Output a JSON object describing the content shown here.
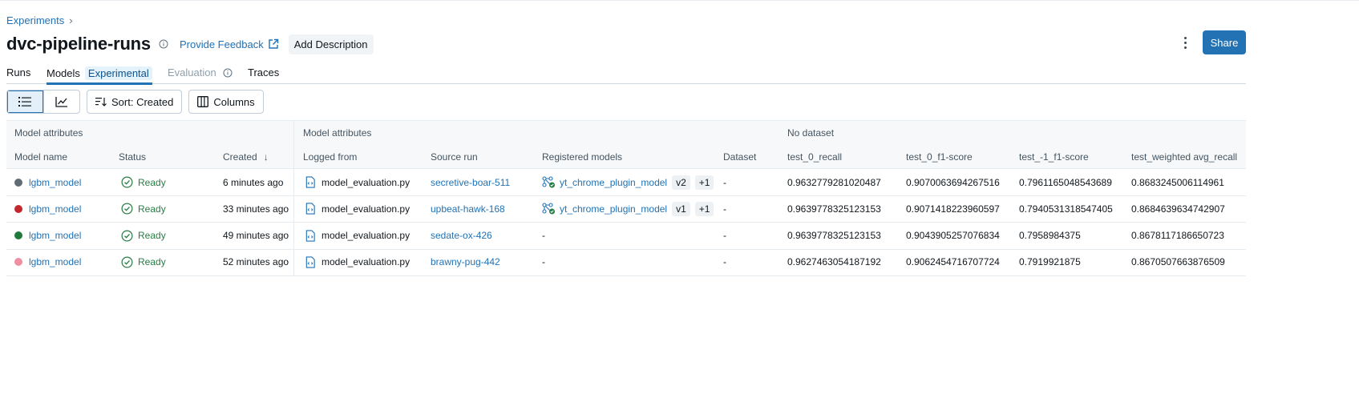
{
  "breadcrumb": {
    "parent": "Experiments",
    "separator": "›"
  },
  "header": {
    "title": "dvc-pipeline-runs",
    "feedback_label": "Provide Feedback",
    "add_description_label": "Add Description",
    "share_label": "Share"
  },
  "tabs": [
    {
      "label": "Runs"
    },
    {
      "label": "Models",
      "badge": "Experimental"
    },
    {
      "label": "Evaluation"
    },
    {
      "label": "Traces"
    }
  ],
  "toolbar": {
    "sort_label": "Sort: Created",
    "columns_label": "Columns"
  },
  "table": {
    "groups": [
      "Model attributes",
      "Model attributes",
      "No dataset"
    ],
    "columns": [
      "Model name",
      "Status",
      "Created",
      "Logged from",
      "Source run",
      "Registered models",
      "Dataset",
      "test_0_recall",
      "test_0_f1-score",
      "test_-1_f1-score",
      "test_weighted avg_recall"
    ],
    "sort_arrow": "↓",
    "rows": [
      {
        "color": "#5f6b75",
        "name": "lgbm_model",
        "status": "Ready",
        "created": "6 minutes ago",
        "logged_from": "model_evaluation.py",
        "source_run": "secretive-boar-511",
        "registered": "yt_chrome_plugin_model",
        "version": "v2",
        "more": "+1",
        "dataset": "-",
        "m1": "0.9632779281020487",
        "m2": "0.9070063694267516",
        "m3": "0.7961165048543689",
        "m4": "0.8683245006114961"
      },
      {
        "color": "#c1272d",
        "name": "lgbm_model",
        "status": "Ready",
        "created": "33 minutes ago",
        "logged_from": "model_evaluation.py",
        "source_run": "upbeat-hawk-168",
        "registered": "yt_chrome_plugin_model",
        "version": "v1",
        "more": "+1",
        "dataset": "-",
        "m1": "0.9639778325123153",
        "m2": "0.9071418223960597",
        "m3": "0.7940531318547405",
        "m4": "0.8684639634742907"
      },
      {
        "color": "#217a3c",
        "name": "lgbm_model",
        "status": "Ready",
        "created": "49 minutes ago",
        "logged_from": "model_evaluation.py",
        "source_run": "sedate-ox-426",
        "registered_placeholder": "-",
        "dataset": "-",
        "m1": "0.9639778325123153",
        "m2": "0.9043905257076834",
        "m3": "0.7958984375",
        "m4": "0.8678117186650723"
      },
      {
        "color": "#f08fa2",
        "name": "lgbm_model",
        "status": "Ready",
        "created": "52 minutes ago",
        "logged_from": "model_evaluation.py",
        "source_run": "brawny-pug-442",
        "registered_placeholder": "-",
        "dataset": "-",
        "m1": "0.9627463054187192",
        "m2": "0.9062454716707724",
        "m3": "0.7919921875",
        "m4": "0.8670507663876509"
      }
    ]
  },
  "colors": {
    "accent": "#2272b4",
    "ready": "#277c43"
  }
}
